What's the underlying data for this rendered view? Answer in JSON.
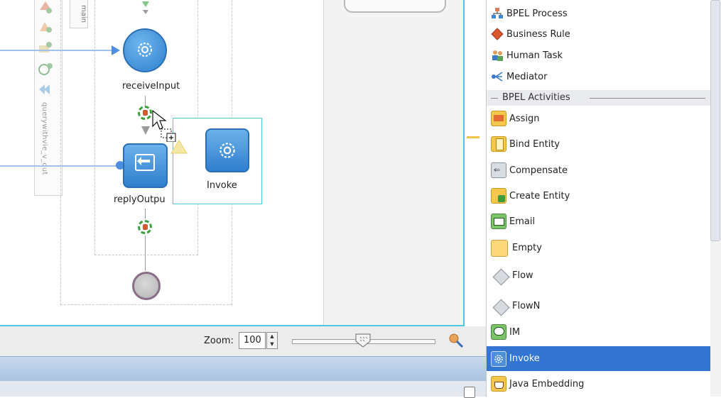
{
  "canvas": {
    "scope_tab_label": "main",
    "partner_link_label": "querywithvie_v_out",
    "nodes": {
      "receive_label": "receiveInput",
      "reply_label": "replyOutpu",
      "drag_preview_label": "Invoke"
    },
    "icons": {
      "receive": "gear-icon",
      "reply": "reply-arrow-icon",
      "drag_preview": "gear-icon",
      "end": "end-circle-icon",
      "cursor": "move-cursor-icon",
      "warning": "warning-icon"
    }
  },
  "zoom": {
    "label": "Zoom:",
    "value": "100",
    "slider_level_percent": 50
  },
  "palette": {
    "top_items": [
      {
        "label": "BPEL Process",
        "icon": "bpel-process-icon"
      },
      {
        "label": "Business Rule",
        "icon": "business-rule-icon"
      },
      {
        "label": "Human Task",
        "icon": "human-task-icon"
      },
      {
        "label": "Mediator",
        "icon": "mediator-icon"
      }
    ],
    "section_title": "BPEL Activities",
    "activities": [
      {
        "label": "Assign",
        "icon": "assign-icon"
      },
      {
        "label": "Bind Entity",
        "icon": "bind-entity-icon"
      },
      {
        "label": "Compensate",
        "icon": "compensate-icon"
      },
      {
        "label": "Create Entity",
        "icon": "create-entity-icon"
      },
      {
        "label": "Email",
        "icon": "email-icon"
      },
      {
        "label": "Empty",
        "icon": "empty-icon"
      },
      {
        "label": "Flow",
        "icon": "flow-icon"
      },
      {
        "label": "FlowN",
        "icon": "flown-icon"
      },
      {
        "label": "IM",
        "icon": "im-icon"
      },
      {
        "label": "Invoke",
        "icon": "gear-icon",
        "selected": true
      },
      {
        "label": "Java Embedding",
        "icon": "java-embedding-icon"
      }
    ]
  },
  "colors": {
    "accent_blue": "#3475d1",
    "activity_blue": "#2f7fce",
    "frame_cyan": "#4cc8e0"
  }
}
